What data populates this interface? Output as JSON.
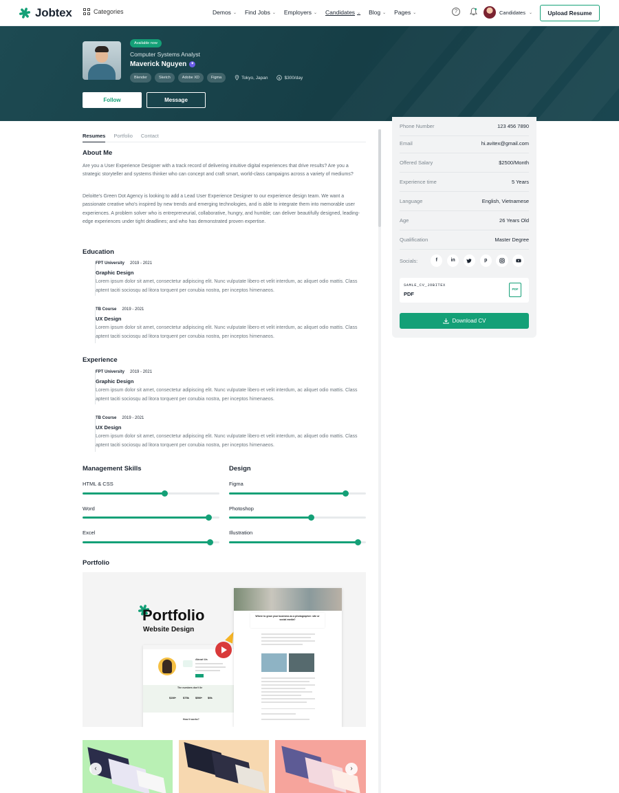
{
  "header": {
    "brand": "Jobtex",
    "categories_label": "Categories",
    "nav": [
      {
        "label": "Demos"
      },
      {
        "label": "Find Jobs"
      },
      {
        "label": "Employers"
      },
      {
        "label": "Candidates",
        "active": true
      },
      {
        "label": "Blog"
      },
      {
        "label": "Pages"
      }
    ],
    "user_name": "Candidates",
    "upload_label": "Upload Resume"
  },
  "profile": {
    "badge": "Available now",
    "role": "Computer Systems Analyst",
    "name": "Maverick Nguyen",
    "skills": [
      "Blender",
      "Sketch",
      "Adobe XD",
      "Figma"
    ],
    "location": "Tokyo, Japan",
    "rate": "$300/day",
    "follow_label": "Follow",
    "message_label": "Message"
  },
  "tabs": [
    "Resumes",
    "Portfolio",
    "Contact"
  ],
  "about": {
    "title": "About Me",
    "p1": "Are you a User Experience Designer with a track record of delivering intuitive digital experiences that drive results? Are you a strategic storyteller and systems thinker who can concept and craft smart, world-class campaigns across a variety of mediums?",
    "p2": "Deloitte's Green Dot Agency is looking to add a Lead User Experience Designer to our experience design team. We want a passionate creative who's inspired by new trends and emerging technologies, and is able to integrate them into memorable user experiences. A problem solver who is entrepreneurial, collaborative, hungry, and humble; can deliver beautifully designed, leading-edge experiences under tight deadlines; and who has demonstrated proven expertise."
  },
  "education": {
    "title": "Education",
    "items": [
      {
        "org": "FPT University",
        "years": "2019 - 2021",
        "title": "Graphic Design",
        "text": "Lorem ipsum dolor sit amet, consectetur adipiscing elit. Nunc vulputate libero et velit interdum, ac aliquet odio mattis. Class aptent taciti sociosqu ad litora torquent per conubia nostra, per inceptos himenaeos."
      },
      {
        "org": "TB Course",
        "years": "2019 - 2021",
        "title": "UX Design",
        "text": "Lorem ipsum dolor sit amet, consectetur adipiscing elit. Nunc vulputate libero et velit interdum, ac aliquet odio mattis. Class aptent taciti sociosqu ad litora torquent per conubia nostra, per inceptos himenaeos."
      }
    ]
  },
  "experience": {
    "title": "Experience",
    "items": [
      {
        "org": "FPT University",
        "years": "2019 - 2021",
        "title": "Graphic Design",
        "text": "Lorem ipsum dolor sit amet, consectetur adipiscing elit. Nunc vulputate libero et velit interdum, ac aliquet odio mattis. Class aptent taciti sociosqu ad litora torquent per conubia nostra, per inceptos himenaeos."
      },
      {
        "org": "TB Course",
        "years": "2019 - 2021",
        "title": "UX Design",
        "text": "Lorem ipsum dolor sit amet, consectetur adipiscing elit. Nunc vulputate libero et velit interdum, ac aliquet odio mattis. Class aptent taciti sociosqu ad litora torquent per conubia nostra, per inceptos himenaeos."
      }
    ]
  },
  "skills": {
    "management_title": "Management Skills",
    "design_title": "Design",
    "management": [
      {
        "label": "HTML & CSS",
        "level": 0.6
      },
      {
        "label": "Word",
        "level": 0.92
      },
      {
        "label": "Excel",
        "level": 0.93
      }
    ],
    "design": [
      {
        "label": "Figma",
        "level": 0.85
      },
      {
        "label": "Photoshop",
        "level": 0.6
      },
      {
        "label": "Illustration",
        "level": 0.94
      }
    ]
  },
  "portfolio": {
    "title": "Portfolio",
    "hero_title": "Portfolio",
    "hero_subtitle": "Website Design",
    "mock_heading": "Where to grow your business as a photographer: site or social media?",
    "mock_about": "About Us",
    "mock_stats_title": "The numbers don't lie",
    "mock_stats": [
      "$1M+",
      "$75k",
      "$5M+",
      "$9k"
    ],
    "mock_how": "How it works?"
  },
  "sidebar": {
    "info": [
      {
        "key": "Phone Number",
        "value": "123 456 7890"
      },
      {
        "key": "Email",
        "value": "hi.avitex@gmail.com"
      },
      {
        "key": "Offered Salary",
        "value": "$2500/Month"
      },
      {
        "key": "Experience time",
        "value": "5 Years"
      },
      {
        "key": "Language",
        "value": "English, Vietnamese"
      },
      {
        "key": "Age",
        "value": "26 Years Old"
      },
      {
        "key": "Qualification",
        "value": "Master Degree"
      }
    ],
    "socials_label": "Socials:",
    "socials": [
      "facebook-icon",
      "linkedin-icon",
      "twitter-icon",
      "pinterest-icon",
      "instagram-icon",
      "youtube-icon"
    ],
    "cv_name": "SAMLE_CV_JOBITEX",
    "cv_type": "PDF",
    "cv_icon_text": "PDF",
    "download_label": "Download CV"
  },
  "colors": {
    "accent": "#14a077",
    "hero_bg": "#1d4a52",
    "verified": "#6b5de6"
  }
}
